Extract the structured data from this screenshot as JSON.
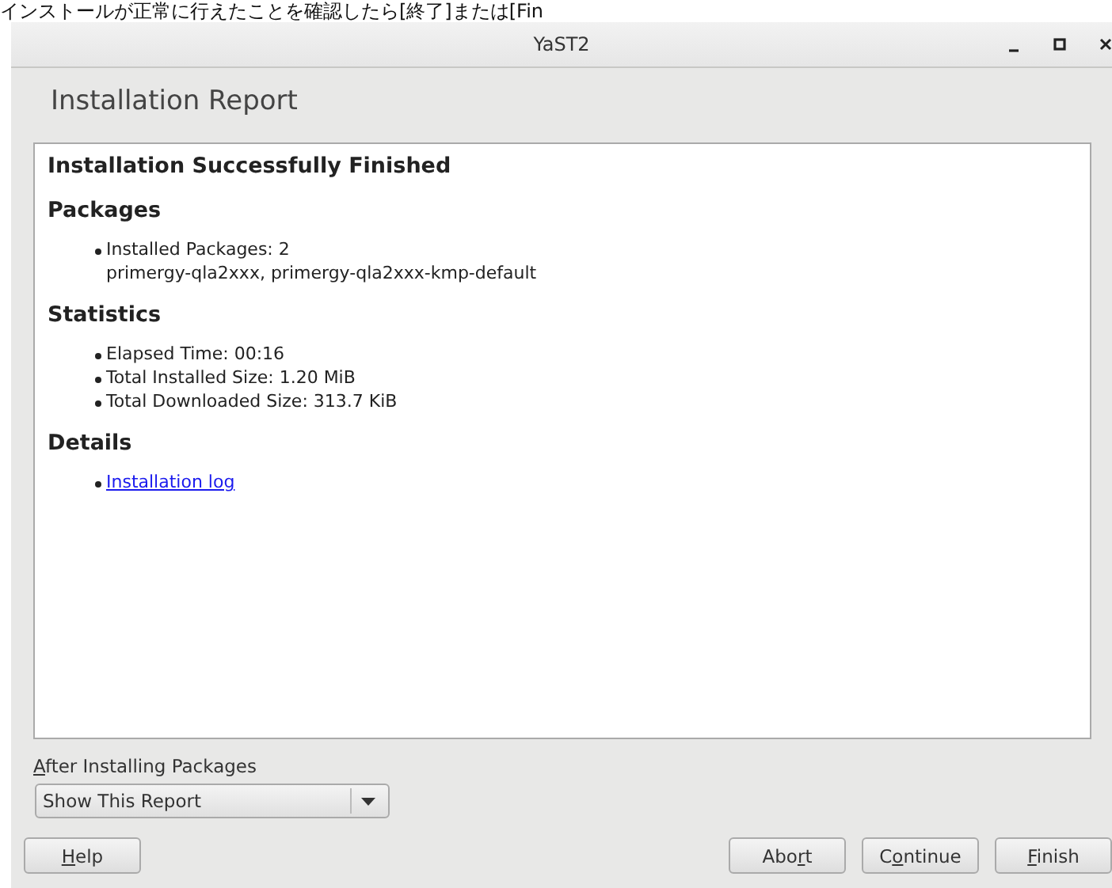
{
  "caption": "インストールが正常に行えたことを確認したら[終了]または[Fin",
  "window": {
    "title": "YaST2"
  },
  "page_title": "Installation Report",
  "report": {
    "title": "Installation Successfully Finished",
    "sections": [
      {
        "heading": "Packages",
        "items": [
          {
            "kind": "text",
            "lines": [
              "Installed Packages: 2",
              "primergy-qla2xxx, primergy-qla2xxx-kmp-default"
            ]
          }
        ]
      },
      {
        "heading": "Statistics",
        "items": [
          {
            "kind": "text",
            "lines": [
              "Elapsed Time: 00:16"
            ]
          },
          {
            "kind": "text",
            "lines": [
              "Total Installed Size: 1.20 MiB"
            ]
          },
          {
            "kind": "text",
            "lines": [
              "Total Downloaded Size: 313.7 KiB"
            ]
          }
        ]
      },
      {
        "heading": "Details",
        "items": [
          {
            "kind": "link",
            "lines": [
              "Installation log"
            ]
          }
        ]
      }
    ]
  },
  "after_label": {
    "key": "A",
    "post": "fter Installing Packages"
  },
  "after_select": {
    "value": "Show This Report"
  },
  "left_buttons": [
    {
      "key": "H",
      "post": "elp"
    }
  ],
  "right_buttons": [
    {
      "pre": "Abo",
      "key": "r",
      "post": "t"
    },
    {
      "pre": "C",
      "key": "o",
      "post": "ntinue"
    },
    {
      "key": "F",
      "post": "inish"
    }
  ]
}
